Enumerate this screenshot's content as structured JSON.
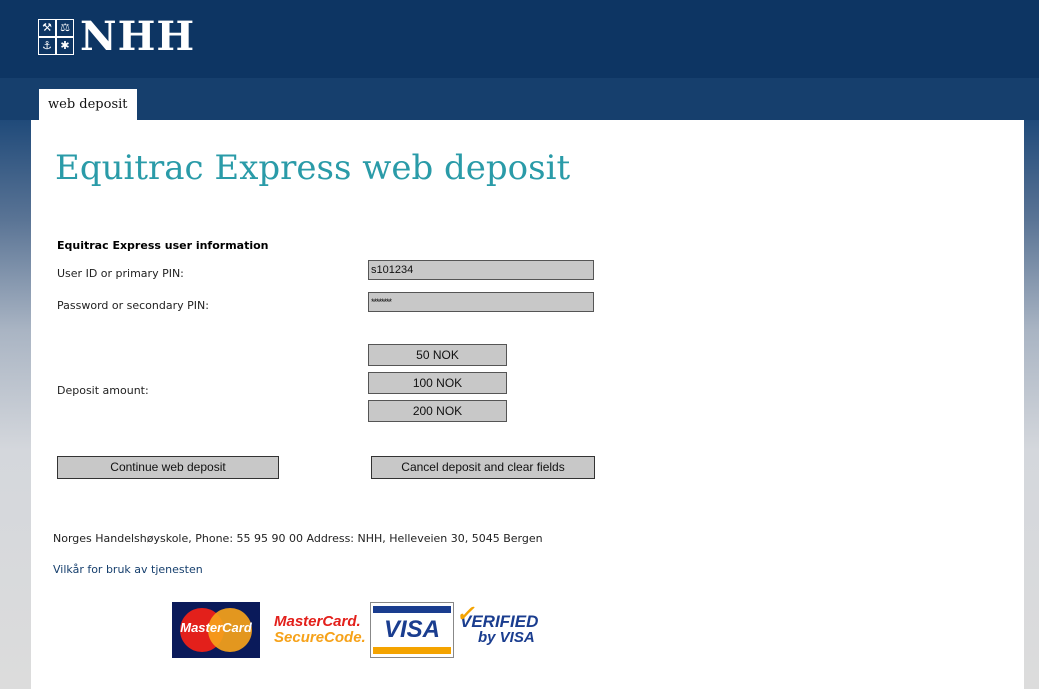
{
  "header": {
    "logo_text": "NHH",
    "logo_glyphs": [
      "⚒",
      "⚖",
      "⚓",
      "✱"
    ]
  },
  "nav": {
    "tab_label": "web deposit"
  },
  "main": {
    "title": "Equitrac Express web deposit",
    "section_title": "Equitrac Express user information",
    "user_id_label": "User ID or primary PIN:",
    "user_id_value": "s101234",
    "password_label": "Password or secondary PIN:",
    "password_value": "********",
    "deposit_label": "Deposit amount:",
    "amounts": [
      "50 NOK",
      "100 NOK",
      "200 NOK"
    ],
    "continue_button": "Continue web deposit",
    "cancel_button": "Cancel deposit and clear fields"
  },
  "footer": {
    "contact": "Norges Handelshøyskole, Phone: 55 95 90 00 Address: NHH, Helleveien 30, 5045 Bergen",
    "terms_link": "Vilkår for bruk av tjenesten",
    "logos": {
      "mastercard": "MasterCard",
      "mc_securecode_1": "MasterCard.",
      "mc_securecode_2": "SecureCode.",
      "visa": "VISA",
      "verified_1": "VERIFIED",
      "verified_2": "by VISA"
    }
  },
  "colors": {
    "header_bg": "#0d3563",
    "title": "#2a9ba8",
    "field_bg": "#c8c8c8",
    "link": "#163f6d"
  }
}
